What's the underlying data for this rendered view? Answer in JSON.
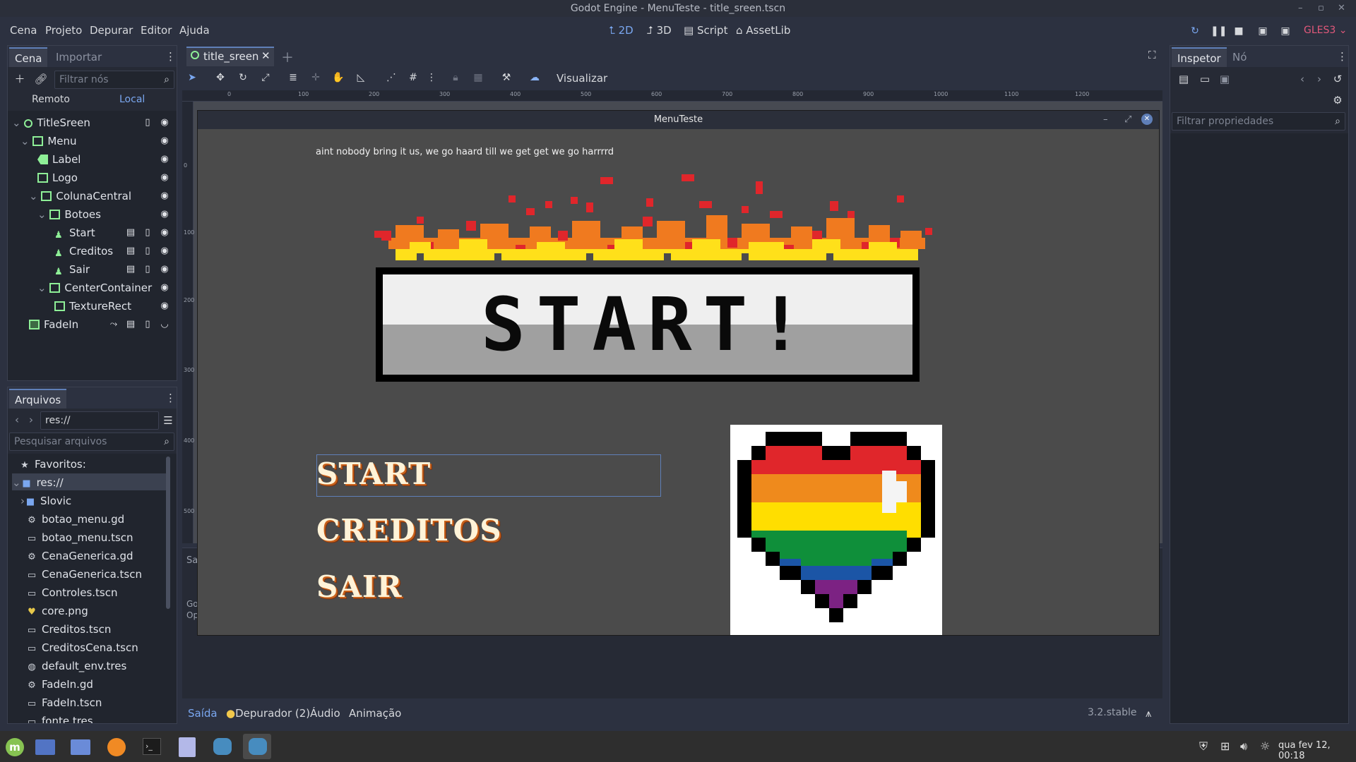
{
  "window": {
    "title": "Godot Engine - MenuTeste - title_sreen.tscn"
  },
  "menubar": {
    "items": [
      "Cena",
      "Projeto",
      "Depurar",
      "Editor",
      "Ajuda"
    ],
    "workspaces": [
      "2D",
      "3D",
      "Script",
      "AssetLib"
    ],
    "active_workspace": "2D",
    "renderer": "GLES3"
  },
  "scene_dock": {
    "tabs": [
      "Cena",
      "Importar"
    ],
    "filter_placeholder": "Filtrar nós",
    "modes": [
      "Remoto",
      "Local"
    ],
    "tree": [
      {
        "label": "TitleSreen",
        "depth": 0,
        "icon": "node-circle-icon"
      },
      {
        "label": "Menu",
        "depth": 1,
        "icon": "vbox-icon"
      },
      {
        "label": "Label",
        "depth": 2,
        "icon": "label-icon"
      },
      {
        "label": "Logo",
        "depth": 2,
        "icon": "texture-icon"
      },
      {
        "label": "ColunaCentral",
        "depth": 2,
        "icon": "hbox-icon"
      },
      {
        "label": "Botoes",
        "depth": 3,
        "icon": "vbox-icon"
      },
      {
        "label": "Start",
        "depth": 4,
        "icon": "instance-icon"
      },
      {
        "label": "Creditos",
        "depth": 4,
        "icon": "instance-icon"
      },
      {
        "label": "Sair",
        "depth": 4,
        "icon": "instance-icon"
      },
      {
        "label": "CenterContainer",
        "depth": 3,
        "icon": "center-container-icon"
      },
      {
        "label": "TextureRect",
        "depth": 4,
        "icon": "texture-icon"
      },
      {
        "label": "FadeIn",
        "depth": 1,
        "icon": "colorrect-icon"
      }
    ]
  },
  "filesystem": {
    "tab": "Arquivos",
    "path": "res://",
    "search_placeholder": "Pesquisar arquivos",
    "favorites_label": "Favoritos:",
    "entries": [
      {
        "name": "res://",
        "icon": "folder-icon"
      },
      {
        "name": "Slovic",
        "icon": "folder-icon"
      },
      {
        "name": "botao_menu.gd",
        "icon": "gear-icon"
      },
      {
        "name": "botao_menu.tscn",
        "icon": "scene-icon"
      },
      {
        "name": "CenaGenerica.gd",
        "icon": "gear-icon"
      },
      {
        "name": "CenaGenerica.tscn",
        "icon": "scene-icon"
      },
      {
        "name": "Controles.tscn",
        "icon": "scene-icon"
      },
      {
        "name": "core.png",
        "icon": "image-icon"
      },
      {
        "name": "Creditos.tscn",
        "icon": "scene-icon"
      },
      {
        "name": "CreditosCena.tscn",
        "icon": "scene-icon"
      },
      {
        "name": "default_env.tres",
        "icon": "globe-icon"
      },
      {
        "name": "FadeIn.gd",
        "icon": "gear-icon"
      },
      {
        "name": "FadeIn.tscn",
        "icon": "scene-icon"
      },
      {
        "name": "fonte.tres",
        "icon": "scene-icon"
      }
    ]
  },
  "editor": {
    "scene_tab": "title_sreen",
    "toolbar_view_label": "Visualizar",
    "ruler_ticks": [
      "0",
      "100",
      "200",
      "300",
      "400",
      "500",
      "600",
      "700",
      "800",
      "900",
      "1000",
      "1100",
      "1200"
    ],
    "vruler_ticks": [
      "0",
      "100",
      "200",
      "300",
      "400",
      "500"
    ]
  },
  "game_window": {
    "title": "MenuTeste",
    "label_text": "aint nobody bring it us, we go haard till we get get we go harrrrd",
    "logo_text": "START!",
    "buttons": [
      "START",
      "CREDITOS",
      "SAIR"
    ]
  },
  "bottom_panel": {
    "tabs": [
      "Saída",
      "Depurador (2)",
      "Áudio",
      "Animação"
    ],
    "version": "3.2.stable",
    "output_partial": [
      "Sa",
      "Go",
      "Op"
    ]
  },
  "inspector": {
    "tabs": [
      "Inspetor",
      "Nó"
    ],
    "filter_placeholder": "Filtrar propriedades"
  },
  "taskbar": {
    "clock": "qua fev 12, 00:18"
  },
  "colors": {
    "accent": "#7aa7f0",
    "editor_bg": "#2c3140",
    "panel_bg": "#262a35",
    "game_bg": "#4b4b4b"
  }
}
